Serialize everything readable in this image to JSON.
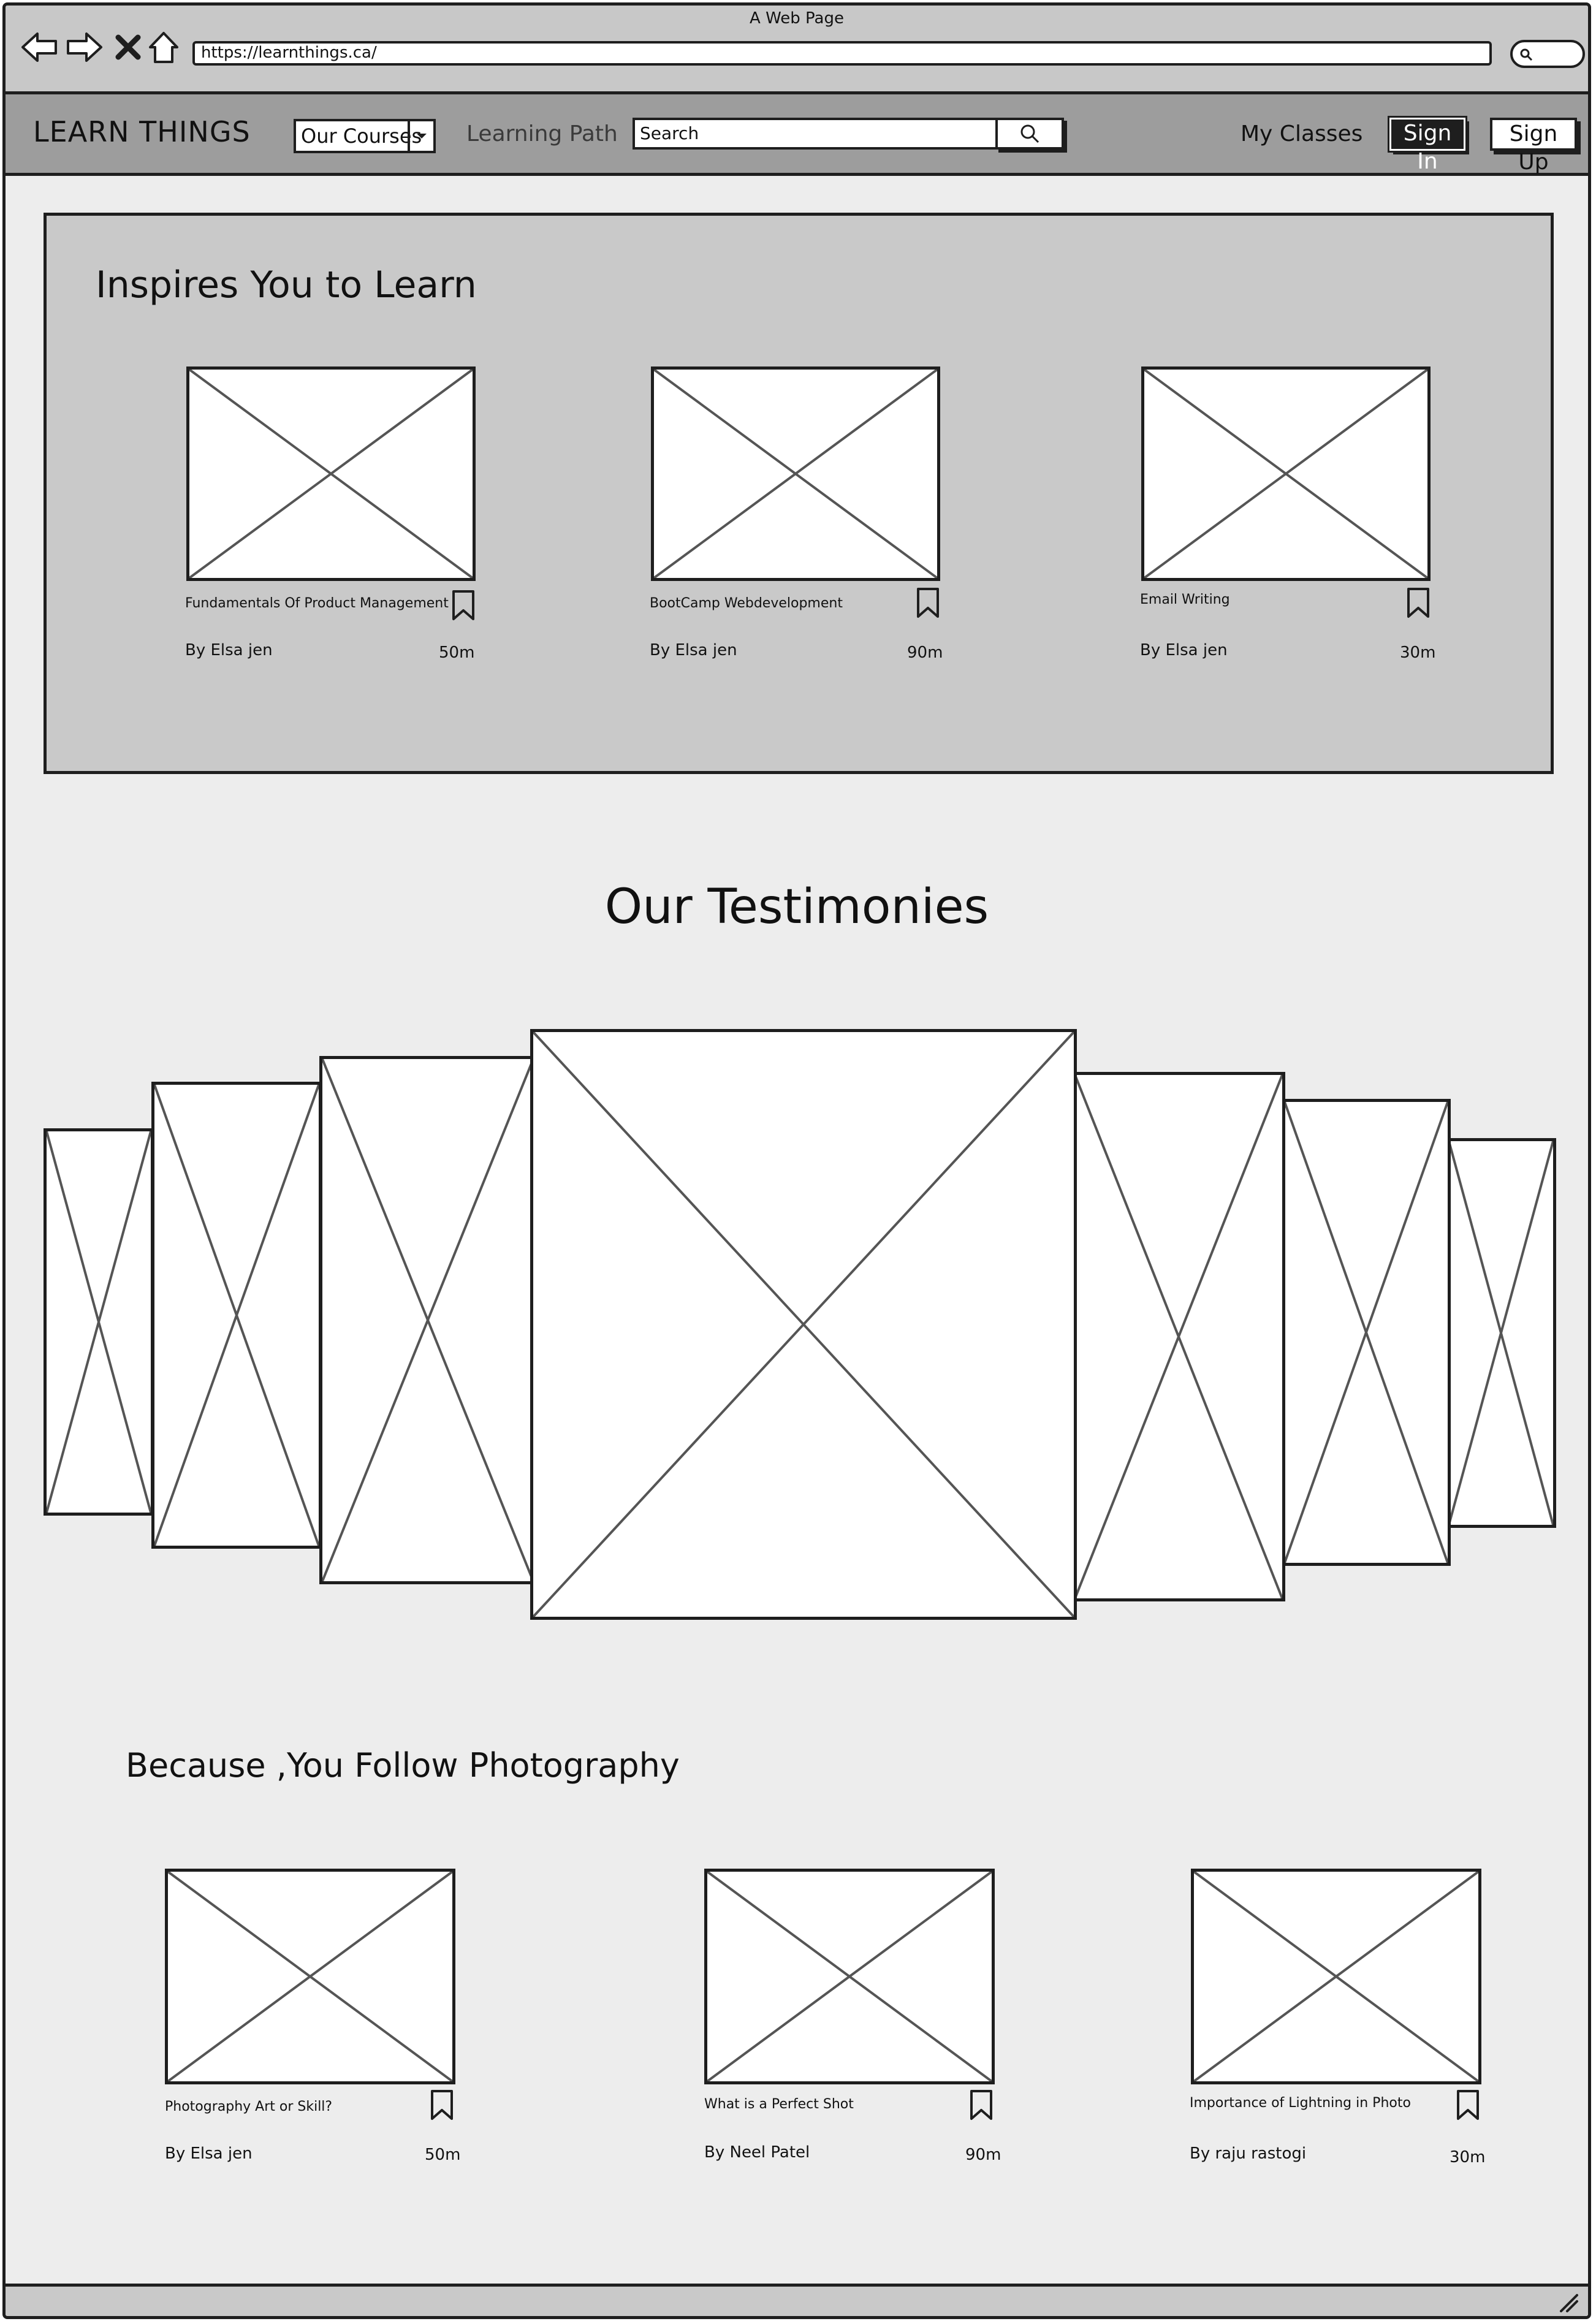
{
  "browser": {
    "window_title": "A Web Page",
    "url": "https://learnthings.ca/"
  },
  "header": {
    "logo": "LEARN THINGS",
    "courses_dropdown": "Our Courses",
    "learning_path": "Learning Path",
    "search_placeholder": "Search",
    "my_classes": "My Classes",
    "sign_in": "Sign In",
    "sign_up": "Sign Up"
  },
  "inspire": {
    "title": "Inspires You to Learn",
    "cards": [
      {
        "title": "Fundamentals Of Product Management",
        "author": "By Elsa jen",
        "duration": "50m"
      },
      {
        "title": "BootCamp Webdevelopment",
        "author": "By Elsa jen",
        "duration": "90m"
      },
      {
        "title": "Email Writing",
        "author": "By Elsa jen",
        "duration": "30m"
      }
    ]
  },
  "testimonies": {
    "title": "Our Testimonies"
  },
  "photography": {
    "title": "Because ,You Follow Photography",
    "cards": [
      {
        "title": "Photography Art or Skill?",
        "author": "By Elsa jen",
        "duration": "50m"
      },
      {
        "title": "What is a Perfect Shot",
        "author": "By Neel Patel",
        "duration": "90m"
      },
      {
        "title": "Importance of Lightning in Photo",
        "author": "By raju rastogi",
        "duration": "30m"
      }
    ]
  },
  "colors": {
    "chrome": "#c8c8c8",
    "nav": "#9d9d9d",
    "hero": "#c9c9c9",
    "page": "#ededed",
    "ink": "#1e1e1e"
  },
  "icons": [
    "back-arrow-icon",
    "forward-arrow-icon",
    "close-icon",
    "home-icon",
    "search-icon",
    "bookmark-icon",
    "caret-down-icon",
    "resize-grip-icon"
  ]
}
